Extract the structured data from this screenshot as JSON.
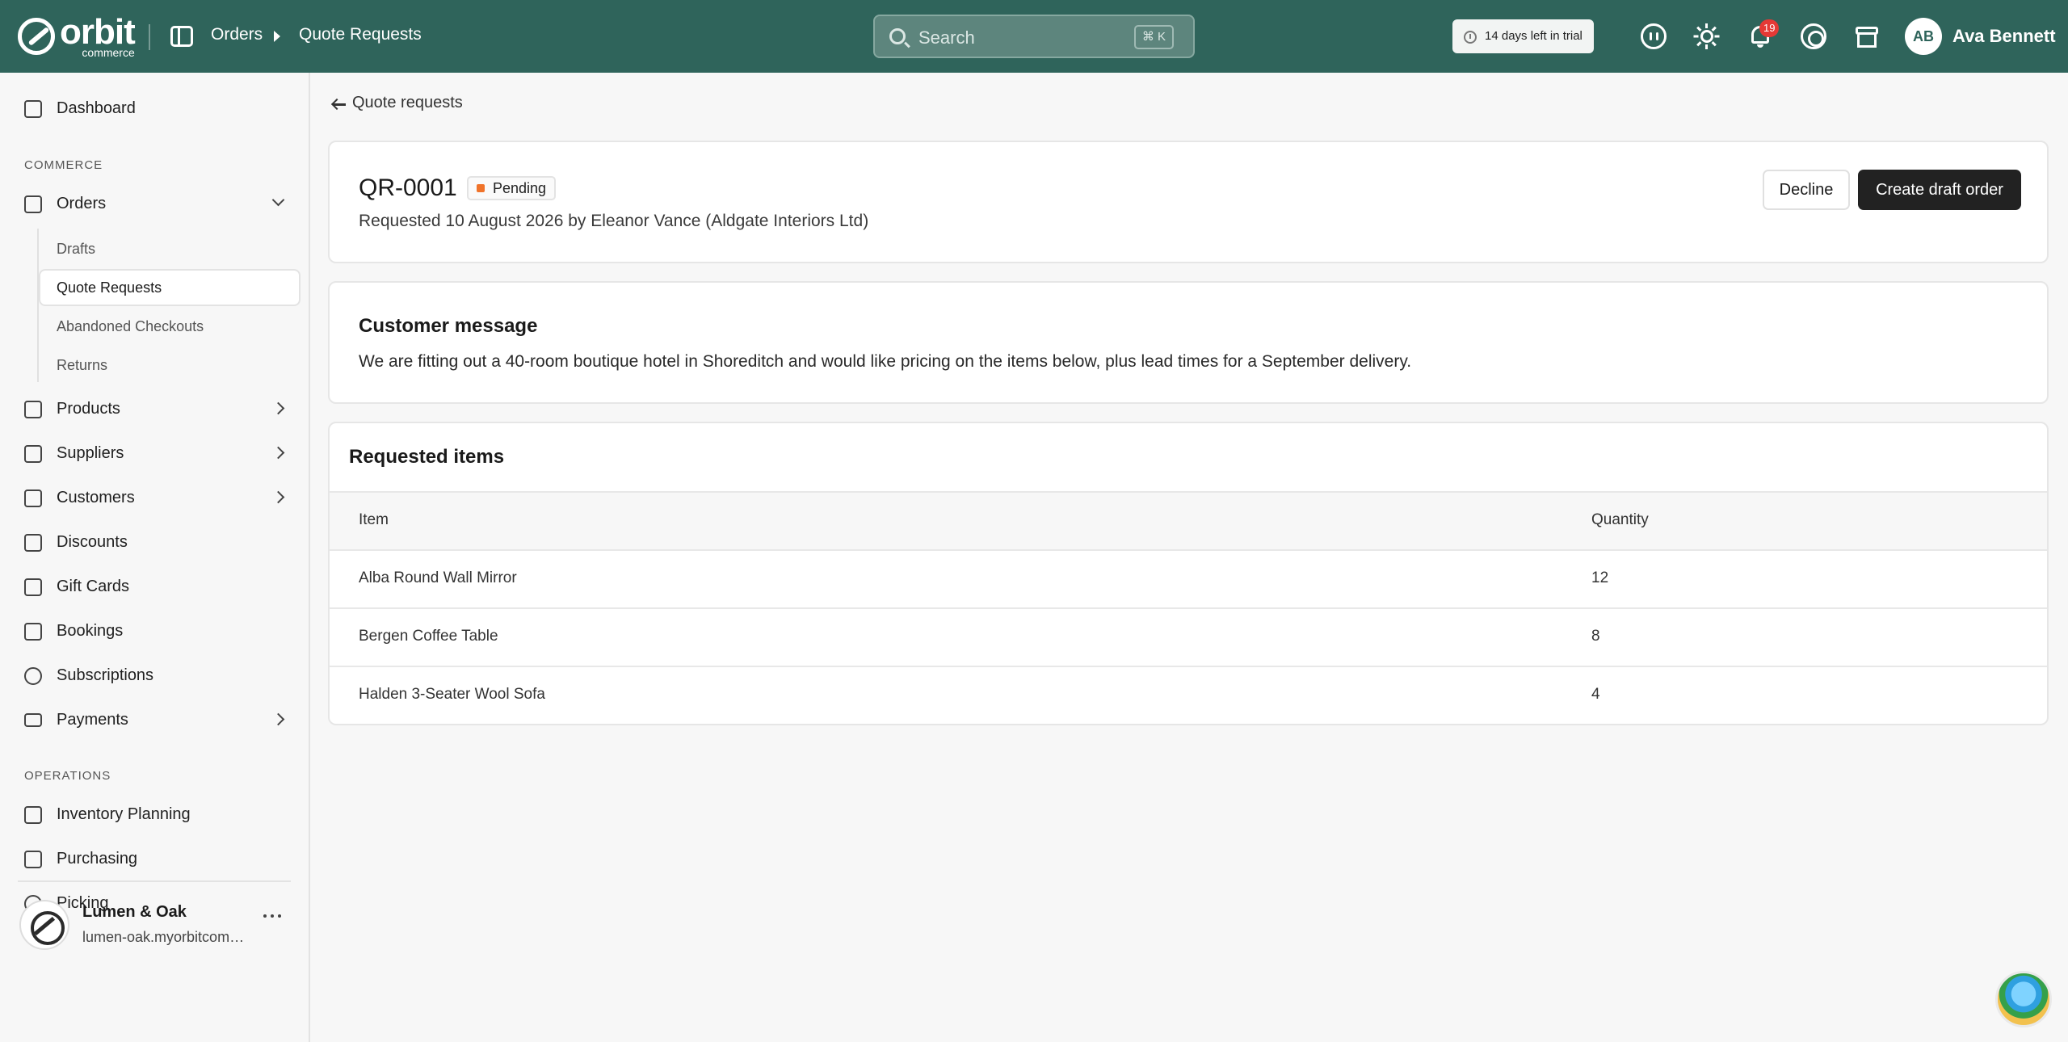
{
  "brand": {
    "name": "orbit",
    "sub": "commerce"
  },
  "breadcrumb": {
    "parent": "Orders",
    "current": "Quote Requests"
  },
  "search": {
    "placeholder": "Search",
    "shortcut": "⌘ K"
  },
  "trial": {
    "text": "14 days left in trial"
  },
  "notifications": {
    "count": "19"
  },
  "user": {
    "initials": "AB",
    "name": "Ava Bennett"
  },
  "sidebar": {
    "dashboard": "Dashboard",
    "section_commerce": "COMMERCE",
    "orders": "Orders",
    "orders_sub": [
      "Drafts",
      "Quote Requests",
      "Abandoned Checkouts",
      "Returns"
    ],
    "products": "Products",
    "suppliers": "Suppliers",
    "customers": "Customers",
    "discounts": "Discounts",
    "gift_cards": "Gift Cards",
    "bookings": "Bookings",
    "subscriptions": "Subscriptions",
    "payments": "Payments",
    "section_operations": "OPERATIONS",
    "inventory_planning": "Inventory Planning",
    "purchasing": "Purchasing",
    "picking": "Picking"
  },
  "store": {
    "name": "Lumen & Oak",
    "url": "lumen-oak.myorbitcommerce.com"
  },
  "main": {
    "back_label": "Quote requests",
    "quote_id": "QR-0001",
    "status": "Pending",
    "requested_line": "Requested 10 August 2026 by Eleanor Vance (Aldgate Interiors Ltd)",
    "decline_label": "Decline",
    "create_label": "Create draft order",
    "message_title": "Customer message",
    "message_body": "We are fitting out a 40-room boutique hotel in Shoreditch and would like pricing on the items below, plus lead times for a September delivery.",
    "items_title": "Requested items",
    "columns": [
      "Item",
      "Quantity"
    ],
    "items": [
      {
        "name": "Alba Round Wall Mirror",
        "qty": "12"
      },
      {
        "name": "Bergen Coffee Table",
        "qty": "8"
      },
      {
        "name": "Halden 3-Seater Wool Sofa",
        "qty": "4"
      }
    ]
  },
  "colors": {
    "topbar": "#2f645b",
    "status_pending": "#f0732a",
    "primary_button": "#222222"
  }
}
